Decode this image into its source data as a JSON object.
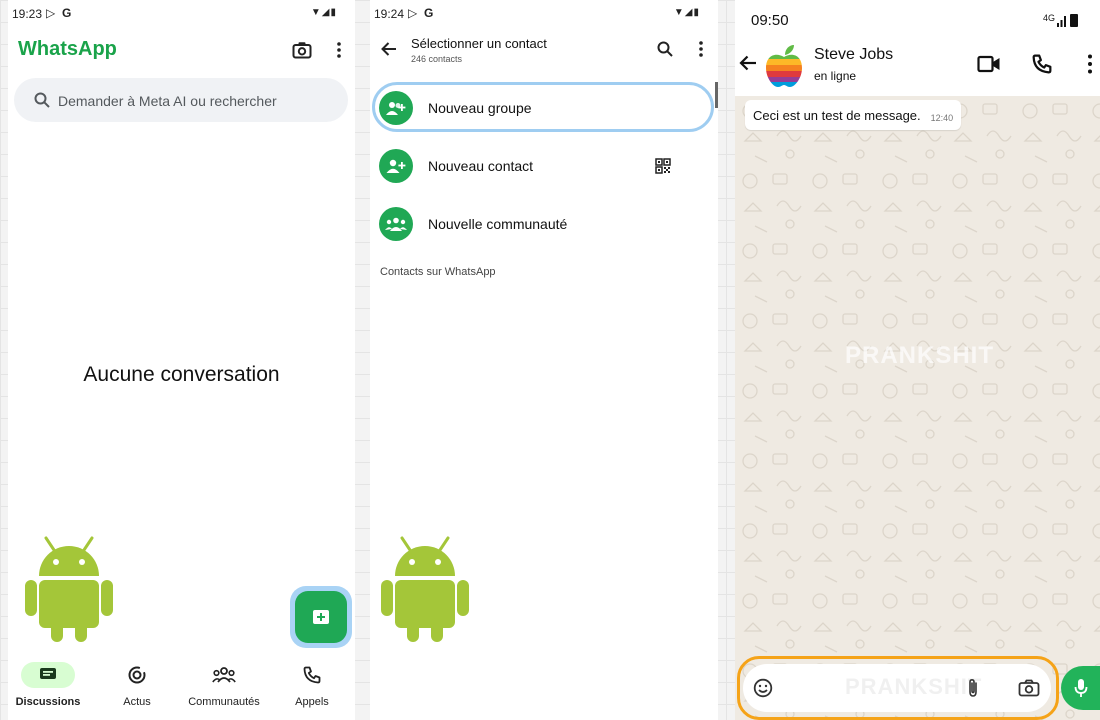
{
  "screen1": {
    "status_time": "19:23",
    "status_icons": "▼◢▮",
    "app_title": "WhatsApp",
    "search_placeholder": "Demander à Meta AI ou rechercher",
    "empty_text": "Aucune conversation",
    "nav": [
      {
        "label": "Discussions",
        "icon": "chat-icon",
        "active": true
      },
      {
        "label": "Actus",
        "icon": "status-icon"
      },
      {
        "label": "Communautés",
        "icon": "communities-icon"
      },
      {
        "label": "Appels",
        "icon": "phone-icon"
      }
    ]
  },
  "screen2": {
    "status_time": "19:24",
    "status_icons": "▼◢▮",
    "header_title": "Sélectionner un contact",
    "header_subtitle": "246 contacts",
    "rows": [
      {
        "label": "Nouveau groupe",
        "icon": "new-group-icon"
      },
      {
        "label": "Nouveau contact",
        "icon": "new-contact-icon"
      },
      {
        "label": "Nouvelle communauté",
        "icon": "new-community-icon"
      }
    ],
    "section_label": "Contacts sur WhatsApp"
  },
  "screen3": {
    "status_time": "09:50",
    "network": "4G",
    "watermark": "PRANKSHIT",
    "contact_name": "Steve Jobs",
    "presence": "en ligne",
    "message_text": "Ceci est un test de message.",
    "message_time": "12:40"
  },
  "colors": {
    "whatsapp_green": "#1aa34a",
    "fab_green": "#1fa855",
    "highlight_blue": "#9fcdf1",
    "highlight_orange": "#f5a318",
    "android_green": "#a4c639"
  }
}
